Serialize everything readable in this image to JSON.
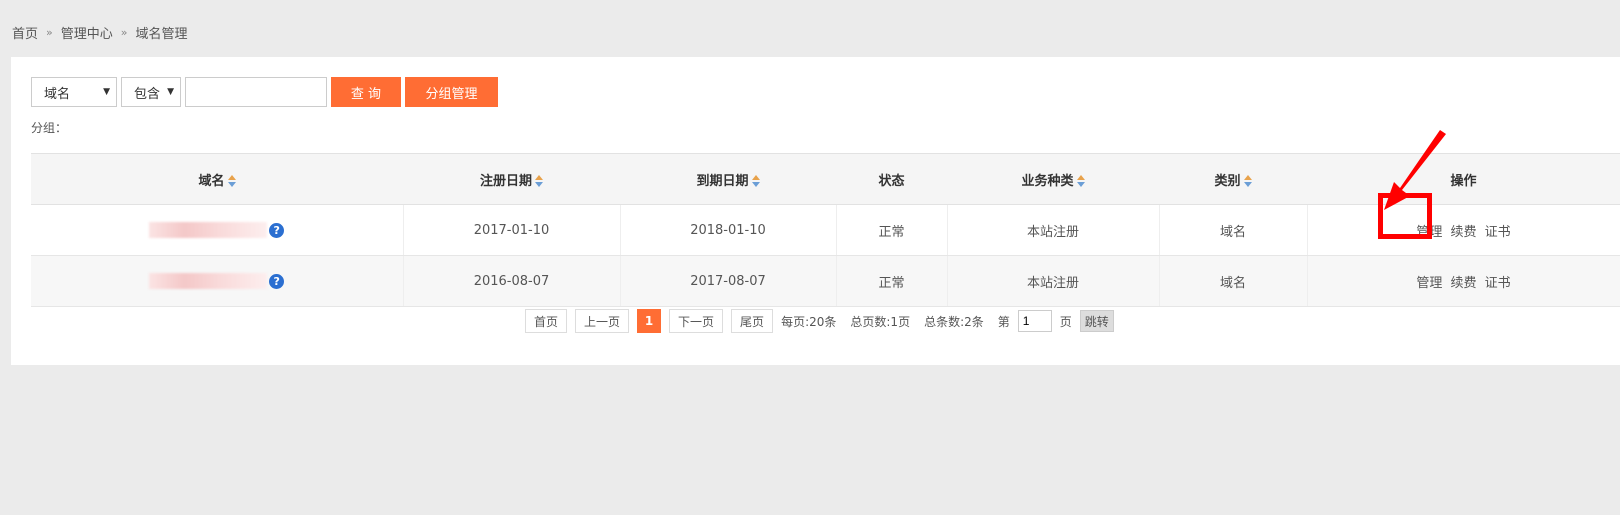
{
  "breadcrumb": [
    "首页",
    "管理中心",
    "域名管理"
  ],
  "toolbar": {
    "field_select": "域名",
    "match_select": "包含",
    "search_value": "",
    "query_button": "查 询",
    "group_button": "分组管理"
  },
  "group_label": "分组：",
  "table": {
    "headers": [
      "域名",
      "注册日期",
      "到期日期",
      "状态",
      "业务种类",
      "类别",
      "操作"
    ],
    "rows": [
      {
        "reg_date": "2017-01-10",
        "exp_date": "2018-01-10",
        "status": "正常",
        "biz": "本站注册",
        "type": "域名"
      },
      {
        "reg_date": "2016-08-07",
        "exp_date": "2017-08-07",
        "status": "正常",
        "biz": "本站注册",
        "type": "域名"
      }
    ],
    "ops": [
      "管理",
      "续费",
      "证书"
    ]
  },
  "pager": {
    "first": "首页",
    "prev": "上一页",
    "current": "1",
    "next": "下一页",
    "last": "尾页",
    "per_page": "每页:20条",
    "total_pages": "总页数:1页",
    "total_items": "总条数:2条",
    "goto_prefix": "第",
    "goto_value": "1",
    "goto_suffix": "页",
    "jump": "跳转"
  },
  "colors": {
    "accent": "#ff6d34",
    "highlight": "#ff0000"
  }
}
